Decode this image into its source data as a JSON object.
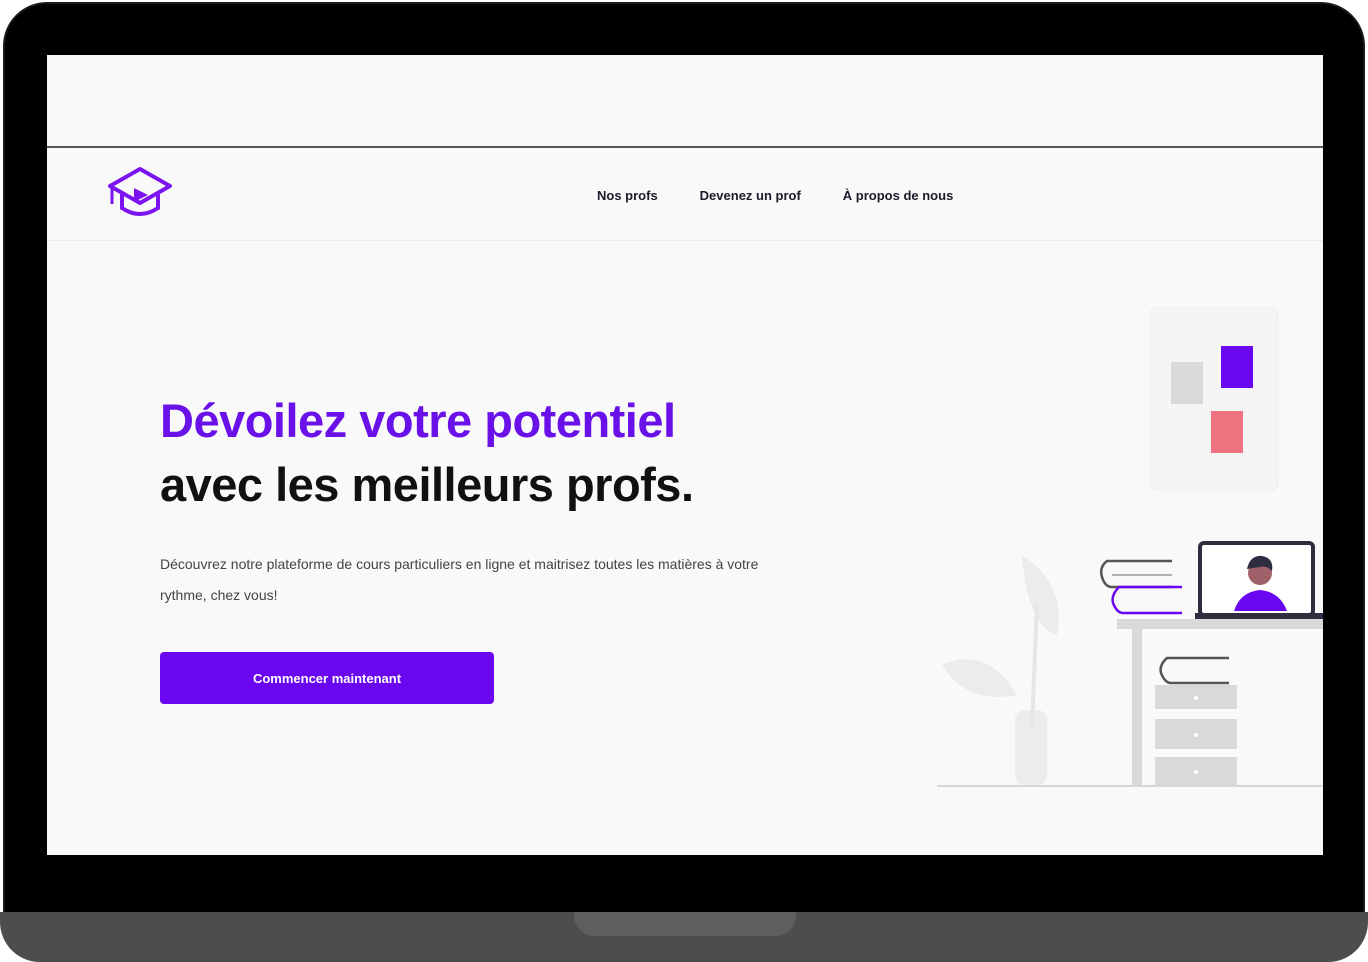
{
  "nav": {
    "links": [
      "Nos profs",
      "Devenez un prof",
      "À propos de nous"
    ]
  },
  "hero": {
    "title_highlight": "Dévoilez votre potentiel",
    "title_rest": "avec les meilleurs profs.",
    "description": "Découvrez notre plateforme de cours particuliers en ligne et maitrisez toutes les matières à votre rythme, chez vous!",
    "cta_label": "Commencer maintenant"
  },
  "colors": {
    "accent": "#6a11ea",
    "button": "#6a06f0",
    "card_pink": "#f07380",
    "card_gray": "#d9d9d9"
  },
  "icons": {
    "logo": "graduation-cap-play-icon",
    "illustration": "online-teacher-desk-illustration"
  }
}
